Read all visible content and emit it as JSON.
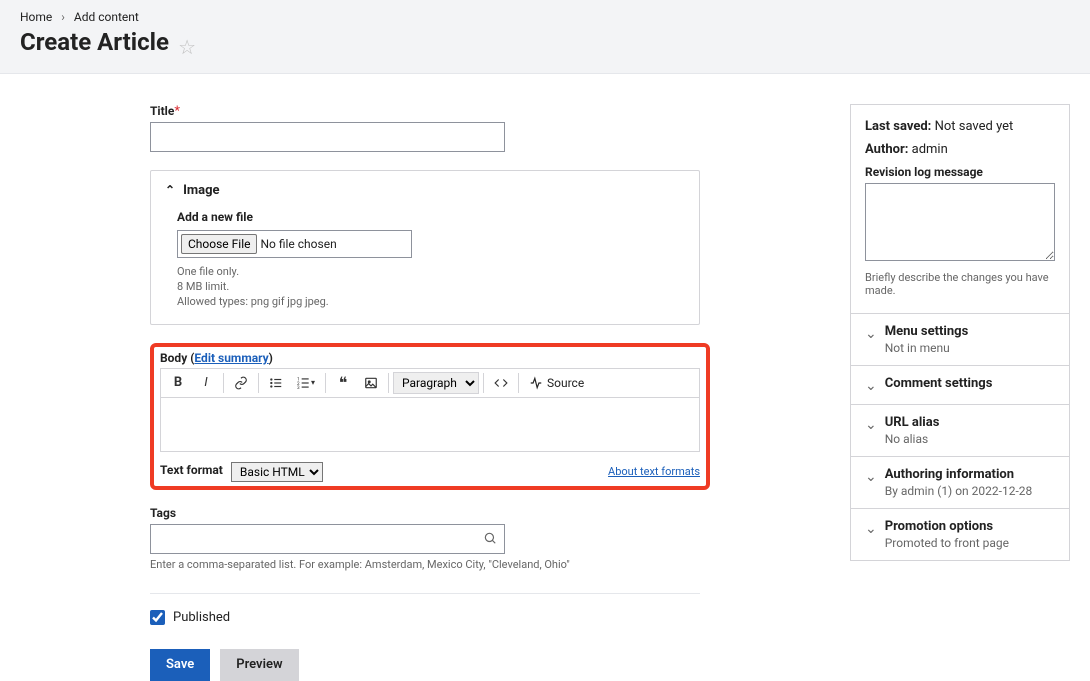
{
  "breadcrumb": {
    "home": "Home",
    "add_content": "Add content"
  },
  "page_title": "Create Article",
  "fields": {
    "title_label": "Title",
    "image": {
      "legend": "Image",
      "add_label": "Add a new file",
      "choose_btn": "Choose File",
      "no_file": "No file chosen",
      "hint1": "One file only.",
      "hint2": "8 MB limit.",
      "hint3": "Allowed types: png gif jpg jpeg."
    },
    "body": {
      "label": "Body",
      "edit_summary": "Edit summary",
      "paragraph": "Paragraph",
      "source": "Source",
      "text_format_label": "Text format",
      "text_format_value": "Basic HTML",
      "about": "About text formats"
    },
    "tags": {
      "label": "Tags",
      "help": "Enter a comma-separated list. For example: Amsterdam, Mexico City, \"Cleveland, Ohio\""
    },
    "published": "Published"
  },
  "buttons": {
    "save": "Save",
    "preview": "Preview"
  },
  "sidebar": {
    "last_saved_label": "Last saved:",
    "last_saved_value": "Not saved yet",
    "author_label": "Author:",
    "author_value": "admin",
    "revision_label": "Revision log message",
    "revision_help": "Briefly describe the changes you have made.",
    "acc": [
      {
        "title": "Menu settings",
        "sub": "Not in menu"
      },
      {
        "title": "Comment settings",
        "sub": ""
      },
      {
        "title": "URL alias",
        "sub": "No alias"
      },
      {
        "title": "Authoring information",
        "sub": "By admin (1) on 2022-12-28"
      },
      {
        "title": "Promotion options",
        "sub": "Promoted to front page"
      }
    ]
  }
}
